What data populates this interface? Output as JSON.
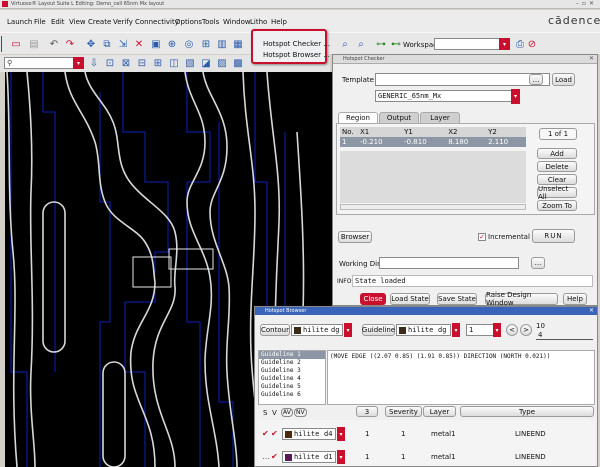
{
  "window": {
    "title": "Virtuoso® Layout Suite L Editing: Demo_cell 65nm Mx layout",
    "brand": "cādence"
  },
  "menubar": [
    "Launch",
    "File",
    "Edit",
    "View",
    "Create",
    "Verify",
    "Connectivity",
    "Options",
    "Tools",
    "Window",
    "Litho",
    "Help"
  ],
  "litho_menu": {
    "items": [
      "Hotspot Checker ...",
      "Hotspot Browser ..."
    ]
  },
  "toolbar": {
    "workspace_label": "Workspace:"
  },
  "search": {
    "placeholder": "Q"
  },
  "hotspot_checker": {
    "title": "Hotspot Checker",
    "template_label": "Template",
    "template_value": "",
    "load_button": "Load",
    "template_select": "GENERIC_65nm_Mx",
    "tabs": [
      "Region",
      "Output",
      "Layer"
    ],
    "table": {
      "headers": [
        "No.",
        "X1",
        "Y1",
        "X2",
        "Y2"
      ],
      "rows": [
        [
          "1",
          "-0.210",
          "-0.810",
          "8.180",
          "2.110"
        ]
      ]
    },
    "page_label": "1 of 1",
    "side_buttons": [
      "Add",
      "Delete",
      "Clear",
      "Unselect All",
      "Zoom To"
    ],
    "browser_button": "Browser",
    "incremental_label": "Incremental",
    "run_button": "RUN",
    "working_dir_label": "Working Dir.",
    "working_dir_value": "",
    "browse_button": "...",
    "info_label": "INFO",
    "info_text": "State loaded",
    "bottom_buttons": [
      "Close",
      "Load State",
      "Save State",
      "Raise Design Window",
      "Help"
    ]
  },
  "hotspot_browser": {
    "title": "Hotspot Browser",
    "contour_button": "Contour",
    "contour_layer": "hilite",
    "contour_purpose": "dg",
    "guideline_button": "Guideline",
    "guideline_layer": "hilite",
    "guideline_purpose": "dg",
    "index_value": "1",
    "nav_prev": "<",
    "nav_next": ">",
    "count_total": "10",
    "count_current": "4",
    "guidelines": [
      "Guideline 1",
      "Guideline 2",
      "Guideline 3",
      "Guideline 4",
      "Guideline 5",
      "Guideline 6"
    ],
    "guideline_text": "(MOVE EDGE ((2.07 0.85) (1.91 0.85)) DIRECTION (NORTH 0.021))",
    "filter_buttons": [
      "S",
      "V",
      "AV",
      "NV"
    ],
    "columns": [
      "3",
      "Severity",
      "Layer",
      "Type"
    ],
    "rows": [
      {
        "layer": "hilite",
        "purpose": "d4",
        "num": "1",
        "severity": "1",
        "metal": "metal1",
        "type": "LINEEND"
      },
      {
        "layer": "hilite",
        "purpose": "d1",
        "num": "1",
        "severity": "1",
        "metal": "metal1",
        "type": "LINEEND"
      }
    ]
  },
  "colors": {
    "accent": "#c8102e",
    "canvas": "#000000",
    "drawn": "#0a22b8",
    "contour": "#d8d8d8"
  }
}
